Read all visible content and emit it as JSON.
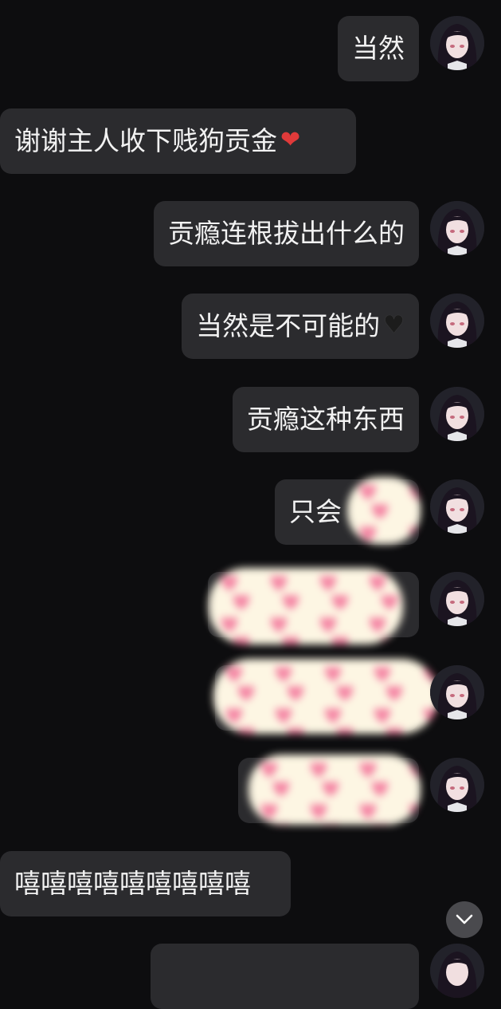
{
  "colors": {
    "background": "#0d0d0f",
    "bubble": "#2b2b2e",
    "text": "#f2f2f2",
    "heart_red": "#e03a3a",
    "heart_black": "#1c1c1c",
    "redaction_bg": "#fdf6e3",
    "redaction_heart": "#f47ea0"
  },
  "messages": [
    {
      "side": "out",
      "text": "当然"
    },
    {
      "side": "in",
      "text": "谢谢主人收下贱狗贡金",
      "emoji": "❤️"
    },
    {
      "side": "out",
      "text": "贡瘾连根拔出什么的"
    },
    {
      "side": "out",
      "text": "当然是不可能的",
      "emoji": "🖤"
    },
    {
      "side": "out",
      "text": "贡瘾这种东西"
    },
    {
      "side": "out",
      "text": "只会",
      "redacted": true
    },
    {
      "side": "out",
      "text": "",
      "redacted": true
    },
    {
      "side": "out",
      "text": "",
      "redacted": true
    },
    {
      "side": "out",
      "text": "",
      "redacted": true
    },
    {
      "side": "in",
      "text": "嘻嘻嘻嘻嘻嘻嘻嘻嘻"
    },
    {
      "side": "out",
      "text": "",
      "partially_visible": true
    }
  ],
  "icons": {
    "avatar": "avatar-image",
    "redaction": "heart-pattern-sticker",
    "scroll": "chevron-down-icon"
  }
}
